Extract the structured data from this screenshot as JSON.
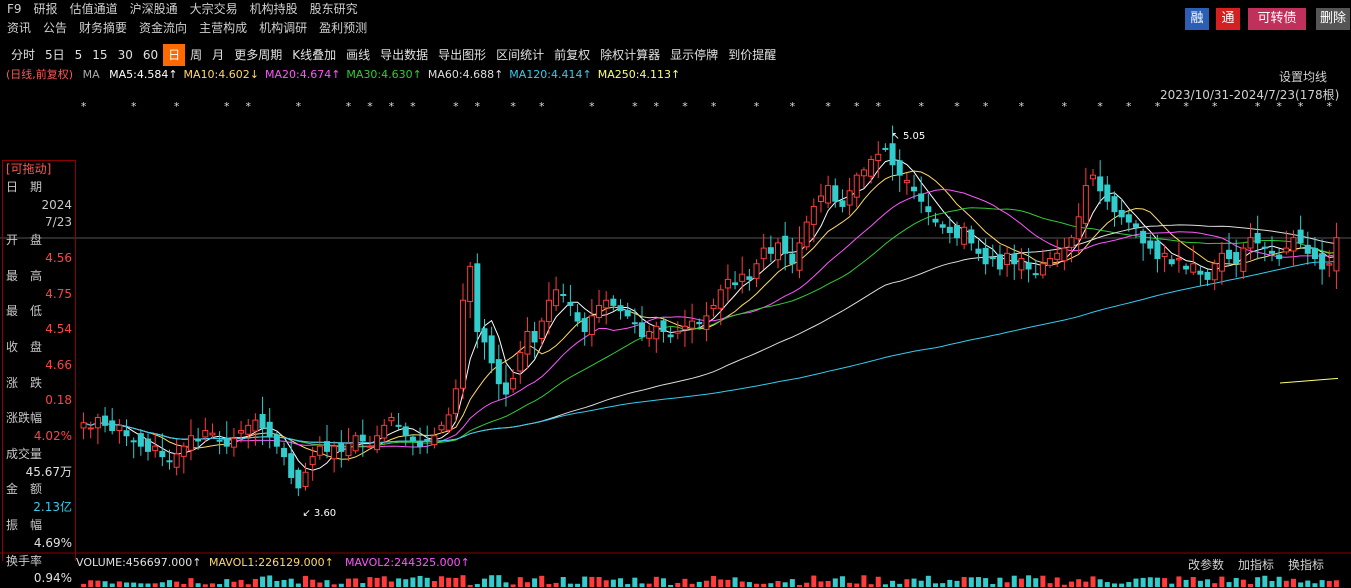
{
  "nav": {
    "row1": [
      "F9",
      "研报",
      "估值通道",
      "沪深股通",
      "大宗交易",
      "机构持股",
      "股东研究"
    ],
    "row2": [
      "资讯",
      "公告",
      "财务摘要",
      "资金流向",
      "主营构成",
      "机构调研",
      "盈利预测"
    ]
  },
  "badges": [
    {
      "label": "融",
      "color": "#2b5fb4"
    },
    {
      "label": "通",
      "color": "#d42020"
    },
    {
      "label": "可转债",
      "color": "#c0305a"
    },
    {
      "label": "删除",
      "color": "#555555"
    }
  ],
  "toolbar": [
    "分时",
    "5日",
    "5",
    "15",
    "30",
    "60",
    "日",
    "周",
    "月",
    "更多周期",
    "K线叠加",
    "画线",
    "导出数据",
    "导出图形",
    "区间统计",
    "前复权",
    "除权计算器",
    "显示停牌",
    "到价提醒"
  ],
  "toolbar_active": "日",
  "legend": {
    "mode": "(日线,前复权)",
    "ma": "MA",
    "items": [
      {
        "text": "MA5:4.584↑",
        "color": "#ffffff"
      },
      {
        "text": "MA10:4.602↓",
        "color": "#ffd966"
      },
      {
        "text": "MA20:4.674↑",
        "color": "#ff55ff"
      },
      {
        "text": "MA30:4.630↑",
        "color": "#33cc33"
      },
      {
        "text": "MA60:4.688↑",
        "color": "#dddddd"
      },
      {
        "text": "MA120:4.414↑",
        "color": "#33ccee"
      },
      {
        "text": "MA250:4.113↑",
        "color": "#ffff77"
      }
    ]
  },
  "settings_label": "设置均线",
  "range_label": "2023/10/31-2024/7/23(178根)",
  "info": {
    "header": "[可拖动]",
    "date_label": "日　期",
    "date_year": "2024",
    "date_md": "7/23",
    "open_label": "开　盘",
    "open": "4.56",
    "high_label": "最　高",
    "high": "4.75",
    "low_label": "最　低",
    "low": "4.54",
    "close_label": "收　盘",
    "close": "4.66",
    "chg_label": "涨　跌",
    "chg": "0.18",
    "pct_label": "涨跌幅",
    "pct": "4.02%",
    "vol_label": "成交量",
    "vol": "45.67万",
    "amt_label": "金　额",
    "amt": "2.13亿",
    "amp_label": "振　幅",
    "amp": "4.69%",
    "turn_label": "换手率",
    "turn": "0.94%"
  },
  "volume_legend": {
    "vol": "VOLUME:456697.000↑",
    "mavol1": "MAVOL1:226129.000↑",
    "mavol2": "MAVOL2:244325.000↑"
  },
  "right_ops": [
    "改参数",
    "加指标",
    "换指标"
  ],
  "chart_data": {
    "type": "candlestick",
    "period": "2023/10/31-2024/7/23",
    "bar_count": 178,
    "annotations": [
      {
        "text": "5.05",
        "type": "high"
      },
      {
        "text": "3.60",
        "type": "low"
      }
    ],
    "ylim": [
      3.5,
      5.15
    ],
    "close_series": [
      3.95,
      3.93,
      3.97,
      3.94,
      3.92,
      3.94,
      3.9,
      3.88,
      3.86,
      3.84,
      3.86,
      3.82,
      3.8,
      3.83,
      3.86,
      3.9,
      3.88,
      3.92,
      3.91,
      3.88,
      3.86,
      3.89,
      3.92,
      3.94,
      3.96,
      3.93,
      3.9,
      3.86,
      3.82,
      3.74,
      3.7,
      3.76,
      3.82,
      3.86,
      3.84,
      3.86,
      3.84,
      3.87,
      3.9,
      3.88,
      3.86,
      3.9,
      3.94,
      3.97,
      3.94,
      3.9,
      3.88,
      3.86,
      3.88,
      3.9,
      3.94,
      3.98,
      4.08,
      4.42,
      4.55,
      4.3,
      4.26,
      4.18,
      4.1,
      4.06,
      4.12,
      4.22,
      4.3,
      4.26,
      4.34,
      4.42,
      4.46,
      4.44,
      4.4,
      4.34,
      4.3,
      4.36,
      4.4,
      4.42,
      4.4,
      4.38,
      4.36,
      4.33,
      4.28,
      4.3,
      4.32,
      4.3,
      4.28,
      4.3,
      4.32,
      4.34,
      4.33,
      4.36,
      4.4,
      4.46,
      4.5,
      4.48,
      4.52,
      4.5,
      4.56,
      4.62,
      4.6,
      4.64,
      4.6,
      4.56,
      4.64,
      4.72,
      4.78,
      4.82,
      4.86,
      4.8,
      4.78,
      4.84,
      4.9,
      4.92,
      4.96,
      4.98,
      5.0,
      4.94,
      4.9,
      4.88,
      4.84,
      4.8,
      4.76,
      4.72,
      4.7,
      4.68,
      4.66,
      4.7,
      4.64,
      4.6,
      4.56,
      4.58,
      4.54,
      4.6,
      4.56,
      4.58,
      4.54,
      4.52,
      4.56,
      4.58,
      4.6,
      4.62,
      4.66,
      4.74,
      4.86,
      4.9,
      4.84,
      4.8,
      4.76,
      4.74,
      4.72,
      4.7,
      4.64,
      4.62,
      4.58,
      4.6,
      4.56,
      4.58,
      4.54,
      4.56,
      4.52,
      4.5,
      4.56,
      4.6,
      4.58,
      4.56,
      4.62,
      4.66,
      4.64,
      4.62,
      4.6,
      4.58,
      4.62,
      4.66,
      4.64,
      4.6,
      4.58,
      4.54,
      4.56,
      4.66
    ],
    "volume_last": 456697
  }
}
